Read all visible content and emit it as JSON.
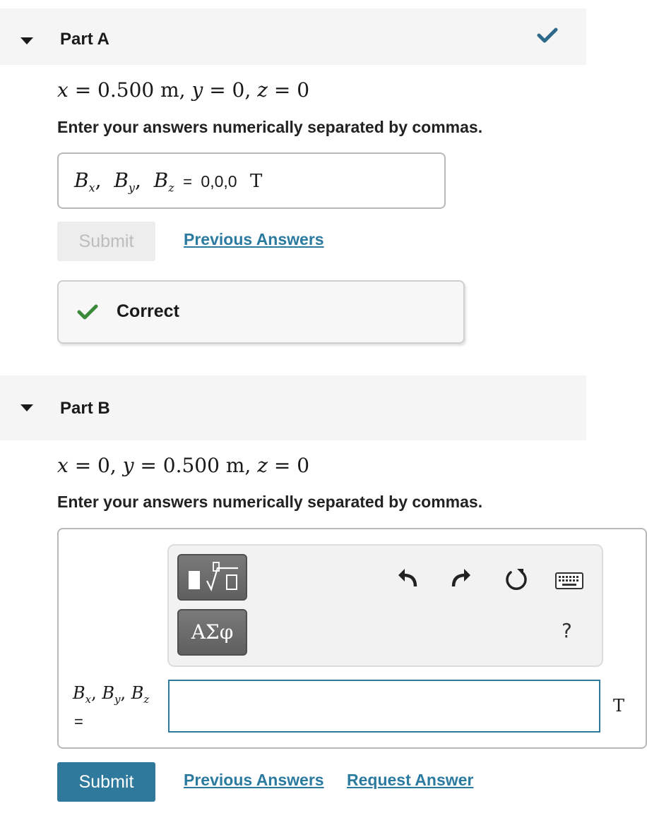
{
  "part_a": {
    "title": "Part A",
    "status_icon": "checkmark-icon",
    "status_color": "#2d6a8a",
    "math": {
      "x": "x",
      "x_val": " = 0.500 m,  ",
      "y": "y",
      "y_val": " = 0, ",
      "z": "z",
      "z_val": " = 0"
    },
    "instruction": "Enter your answers numerically separated by commas.",
    "answer": {
      "label_b": "B",
      "sub_x": "x",
      "sub_y": "y",
      "sub_z": "z",
      "equals": "=",
      "value": "0,0,0",
      "unit": "T"
    },
    "submit_label": "Submit",
    "previous_answers_label": "Previous Answers",
    "feedback": {
      "icon": "checkmark-icon",
      "icon_color": "#3a8a3a",
      "text": "Correct"
    }
  },
  "part_b": {
    "title": "Part B",
    "math": {
      "x": "x",
      "x_val": " = 0, ",
      "y": "y",
      "y_val": " = 0.500 m, ",
      "z": "z",
      "z_val": " = 0"
    },
    "instruction": "Enter your answers numerically separated by commas.",
    "toolbar": {
      "templates_icon": "templates-sqrt-icon",
      "greek_label": "ΑΣφ",
      "undo_icon": "undo-icon",
      "redo_icon": "redo-icon",
      "reset_icon": "reset-icon",
      "keyboard_icon": "keyboard-icon",
      "help_label": "?"
    },
    "answer": {
      "label_b": "B",
      "sub_x": "x",
      "sub_y": "y",
      "sub_z": "z",
      "equals": "=",
      "value": "",
      "unit": "T"
    },
    "submit_label": "Submit",
    "previous_answers_label": "Previous Answers",
    "request_answer_label": "Request Answer"
  },
  "colors": {
    "link": "#2b7a9f",
    "submit": "#2f7a9c",
    "header_bg": "#f5f5f5",
    "input_border": "#2f7a9c"
  }
}
